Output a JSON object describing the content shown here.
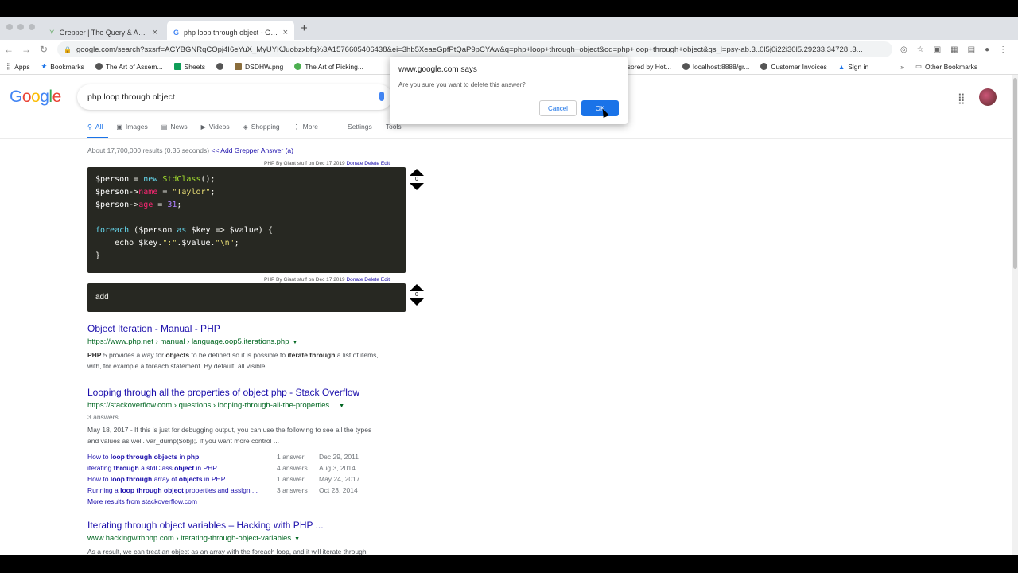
{
  "browser": {
    "tabs": [
      {
        "title": "Grepper | The Query & Answer",
        "active": false
      },
      {
        "title": "php loop through object - Goo",
        "active": true
      }
    ],
    "url": "google.com/search?sxsrf=ACYBGNRqCOpj4I6eYuX_MyUYKJuobzxbfg%3A1576605406438&ei=3hb5XeaeGpfPtQaP9pCYAw&q=php+loop+through+object&oq=php+loop+through+object&gs_l=psy-ab.3..0l5j0i22i30l5.29233.34728..3...",
    "bookmarks": [
      {
        "label": "Apps",
        "icon": "apps-grid-icon"
      },
      {
        "label": "Bookmarks",
        "icon": "star-icon"
      },
      {
        "label": "The Art of Assem...",
        "icon": "globe-icon"
      },
      {
        "label": "Sheets",
        "icon": "sheets-icon"
      },
      {
        "label": "",
        "icon": "globe-icon"
      },
      {
        "label": "DSDHW.png",
        "icon": "image-icon"
      },
      {
        "label": "The Art of Picking...",
        "icon": "globe-icon"
      },
      {
        "label": "Sponsored by Hot...",
        "icon": "globe-icon"
      },
      {
        "label": "localhost:8888/gr...",
        "icon": "globe-icon"
      },
      {
        "label": "Customer Invoices",
        "icon": "globe-icon"
      },
      {
        "label": "Sign in",
        "icon": "drive-icon"
      }
    ],
    "other_bookmarks": "Other Bookmarks",
    "more_chevron": "»"
  },
  "google": {
    "query": "php loop through object",
    "tabs": [
      {
        "label": "All",
        "icon": "search-icon",
        "active": true
      },
      {
        "label": "Images",
        "icon": "image-icon"
      },
      {
        "label": "News",
        "icon": "news-icon"
      },
      {
        "label": "Videos",
        "icon": "video-icon"
      },
      {
        "label": "Shopping",
        "icon": "tag-icon"
      },
      {
        "label": "More",
        "icon": "more-icon"
      }
    ],
    "settings": "Settings",
    "tools": "Tools",
    "stats": "About 17,700,000 results (0.36 seconds)",
    "add_grepper": "<< Add Grepper Answer (a)"
  },
  "grepper": {
    "answer1": {
      "meta": "PHP By Giant stuff on Dec 17 2019",
      "donate": "Donate",
      "delete": "Delete",
      "edit": "Edit",
      "votes": "0"
    },
    "answer2": {
      "meta": "PHP By Giant stuff on Dec 17 2019",
      "donate": "Donate",
      "delete": "Delete",
      "edit": "Edit",
      "code": "add",
      "votes": "0"
    }
  },
  "results": [
    {
      "title": "Object Iteration - Manual - PHP",
      "url": "https://www.php.net › manual › language.oop5.iterations.php",
      "desc_line1": "5 provides a way for",
      "desc_line1b": "to be defined so it is possible to",
      "desc_line1c": "a list of items,",
      "desc_line2": "with, for example a foreach statement. By default, all visible ..."
    },
    {
      "title": "Looping through all the properties of object php - Stack Overflow",
      "url": "https://stackoverflow.com › questions › looping-through-all-the-properties...",
      "answers": "3 answers",
      "desc_line1": "May 18, 2017 - If this is just for debugging output, you can use the following to see all the types",
      "desc_line2": "and values as well. var_dump($obj);. If you want more control ...",
      "sublinks": [
        {
          "pre": "How to ",
          "bold": "loop through objects",
          "mid": " in ",
          "bold2": "php",
          "post": "",
          "answers": "1 answer",
          "date": "Dec 29, 2011"
        },
        {
          "pre": "iterating ",
          "bold": "through",
          "mid": " a stdClass ",
          "bold2": "object",
          "post": " in PHP",
          "answers": "4 answers",
          "date": "Aug 3, 2014"
        },
        {
          "pre": "How to ",
          "bold": "loop through",
          "mid": " array of ",
          "bold2": "objects",
          "post": " in PHP",
          "answers": "1 answer",
          "date": "May 24, 2017"
        },
        {
          "pre": "Running a ",
          "bold": "loop through object",
          "mid": " properties and assign ...",
          "bold2": "",
          "post": "",
          "answers": "3 answers",
          "date": "Oct 23, 2014"
        }
      ],
      "more": "More results from stackoverflow.com"
    },
    {
      "title": "Iterating through object variables – Hacking with PHP ...",
      "url": "www.hackingwithphp.com › iterating-through-object-variables",
      "desc_line1": "As a result, we can treat an object as an array with the foreach loop, and it will iterate through"
    }
  ],
  "dialog": {
    "title": "www.google.com says",
    "message": "Are you sure you want to delete this answer?",
    "cancel": "Cancel",
    "ok": "OK"
  },
  "colors": {
    "link": "#1a0dab",
    "url_green": "#006621",
    "accent_blue": "#1a73e8",
    "code_bg": "#272822"
  }
}
